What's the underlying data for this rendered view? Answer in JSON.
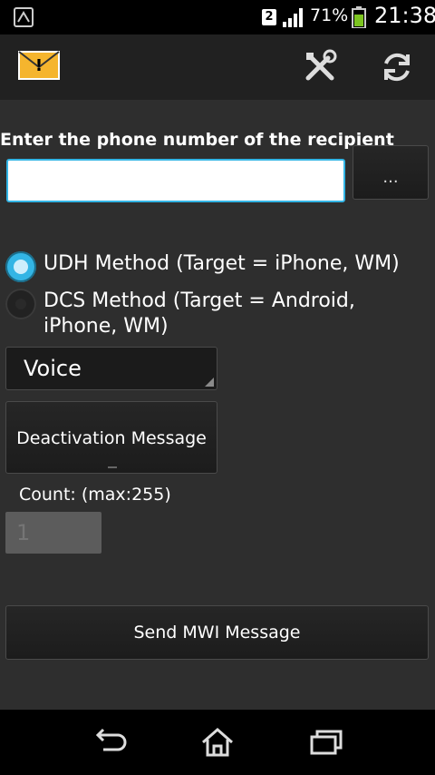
{
  "status_bar": {
    "notification_icon": "app-notification-icon",
    "sim_slot": "2",
    "battery_percent": "71%",
    "time": "21:38",
    "battery_color": "#7cc420"
  },
  "action_bar": {
    "app_icon": "envelope-warning-icon",
    "actions": [
      "tools-icon",
      "refresh-icon"
    ]
  },
  "form": {
    "prompt": "Enter the phone number of the recipient",
    "phone_value": "",
    "contact_button": "...",
    "radio_udh": "UDH Method (Target = iPhone, WM)",
    "radio_dcs": "DCS Method (Target = Android, iPhone, WM)",
    "selected_method": "UDH",
    "type_spinner": "Voice",
    "message_button": "Deactivation Message",
    "count_label": "Count: (max:255)",
    "count_value": "1",
    "send_button": "Send MWI Message"
  },
  "colors": {
    "accent": "#33b5e5",
    "background": "#2e2e2e"
  },
  "nav_bar": [
    "back-icon",
    "home-icon",
    "recents-icon"
  ]
}
